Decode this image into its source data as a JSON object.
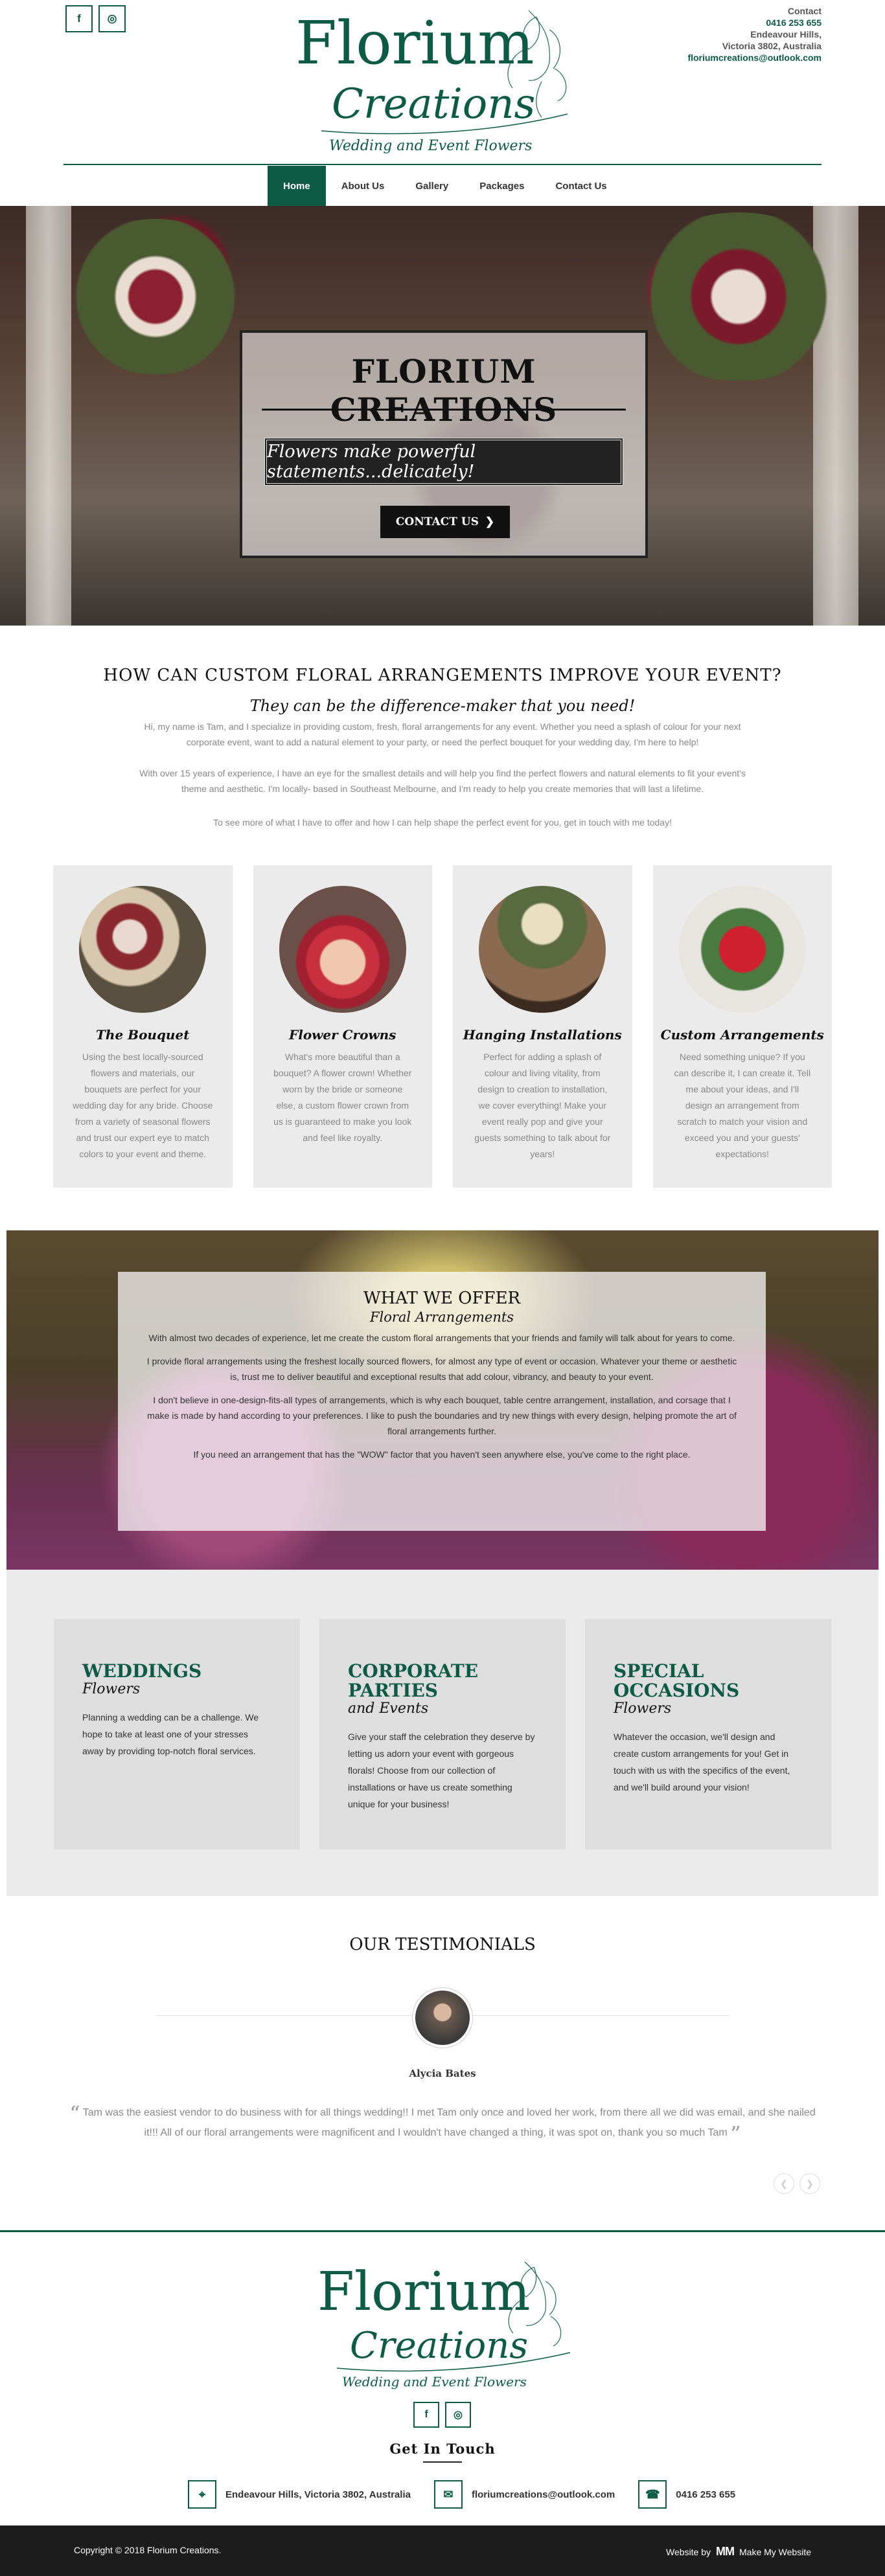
{
  "brand": {
    "name_line1": "Florium",
    "name_line2": "Creations",
    "tagline": "Wedding and Event Flowers",
    "green": "#0d5b45"
  },
  "header": {
    "social": [
      {
        "name": "facebook-icon",
        "glyph": "f"
      },
      {
        "name": "instagram-icon",
        "glyph": "◎"
      }
    ],
    "contact": {
      "label": "Contact",
      "phone": "0416 253 655",
      "address_line1": "Endeavour Hills,",
      "address_line2": "Victoria 3802, Australia",
      "email": "floriumcreations@outlook.com"
    }
  },
  "nav": {
    "items": [
      "Home",
      "About Us",
      "Gallery",
      "Packages",
      "Contact Us"
    ],
    "active": "Home"
  },
  "hero": {
    "title": "FLORIUM CREATIONS",
    "tagline": "Flowers make powerful statements...delicately!",
    "button": "CONTACT US"
  },
  "intro": {
    "heading": "HOW CAN CUSTOM FLORAL ARRANGEMENTS IMPROVE YOUR EVENT?",
    "subheading": "They can be the difference-maker that you need!",
    "p1": "Hi, my name is Tam, and I specialize in providing custom, fresh, floral arrangements for any event. Whether you need a splash of colour for your next corporate event, want to add a natural element to your party, or need the perfect bouquet for your wedding day, I'm here to help!",
    "p2": "With over 15 years of experience, I have an eye for the smallest details and will help you find the perfect flowers and natural elements to fit your event's theme and aesthetic. I'm locally- based in Southeast Melbourne, and I'm ready to help you create memories that will last a lifetime.",
    "p3": "To see more of what I have to offer and how I can help shape the perfect event for you, get in touch with me today!"
  },
  "cards": [
    {
      "title": "The Bouquet",
      "text": "Using the best locally-sourced flowers and materials, our bouquets are perfect for your wedding day for any bride. Choose from a variety of seasonal flowers and trust our expert eye to match colors to your event and theme."
    },
    {
      "title": "Flower Crowns",
      "text": "What's more beautiful than a bouquet? A flower crown! Whether worn by the bride or someone else, a custom flower crown from us is guaranteed to make you look and feel like royalty."
    },
    {
      "title": "Hanging Installations",
      "text": "Perfect for adding a splash of colour and living vitality, from design to creation to installation, we cover everything! Make your event really pop and give your guests something to talk about for years!"
    },
    {
      "title": "Custom Arrangements",
      "text": "Need something unique? If you can describe it, I can create it. Tell me about your ideas, and I'll design an arrangement from scratch to match your vision and exceed you and your guests' expectations!"
    }
  ],
  "offer": {
    "heading": "WHAT WE OFFER",
    "subheading": "Floral Arrangements",
    "p1": "With almost two decades of experience, let me create the custom floral arrangements that your friends and family will talk about for years to come.",
    "p2": "I provide floral arrangements using the freshest locally sourced flowers, for almost any type of event or occasion. Whatever your theme or aesthetic is, trust me to deliver beautiful and exceptional results that add colour, vibrancy, and beauty to your event.",
    "p3": "I don't believe in one-design-fits-all types of arrangements, which is why each bouquet, table centre arrangement, installation, and corsage that I make is made by hand according to your preferences. I like to push the boundaries and try new things with every design, helping promote the art of floral arrangements further.",
    "p4": "If you need an arrangement that has the \"WOW\" factor that you haven't seen anywhere else, you've come to the right place."
  },
  "services": [
    {
      "title": "WEDDINGS",
      "sub": "Flowers",
      "text": "Planning a wedding can be a challenge. We hope to take at least one of your stresses away by providing top-notch floral services."
    },
    {
      "title": "CORPORATE PARTIES",
      "sub": "and Events",
      "text": "Give your staff the celebration they deserve by letting us adorn your event with gorgeous florals! Choose from our collection of installations or have us create something unique for your business!"
    },
    {
      "title": "SPECIAL OCCASIONS",
      "sub": "Flowers",
      "text": "Whatever the occasion, we'll design and create custom arrangements for you! Get in touch with us with the specifics of the event, and we'll build around your vision!"
    }
  ],
  "testimonials": {
    "heading": "OUR TESTIMONIALS",
    "name": "Alycia Bates",
    "quote": "Tam was the easiest vendor to do business with for all things wedding!! I met Tam only once and loved her work, from there all we did was email, and she nailed it!!! All of our floral arrangements were magnificent and I wouldn't have changed a thing, it was spot on, thank you so much Tam"
  },
  "footer": {
    "get_in_touch": "Get In Touch",
    "address": "Endeavour Hills, Victoria 3802, Australia",
    "email": "floriumcreations@outlook.com",
    "phone": "0416 253 655",
    "copyright": "Copyright © 2018 Florium Creations.",
    "website_by": "Website by",
    "mmw_logo": "MM",
    "mmw_name": "Make My Website"
  }
}
